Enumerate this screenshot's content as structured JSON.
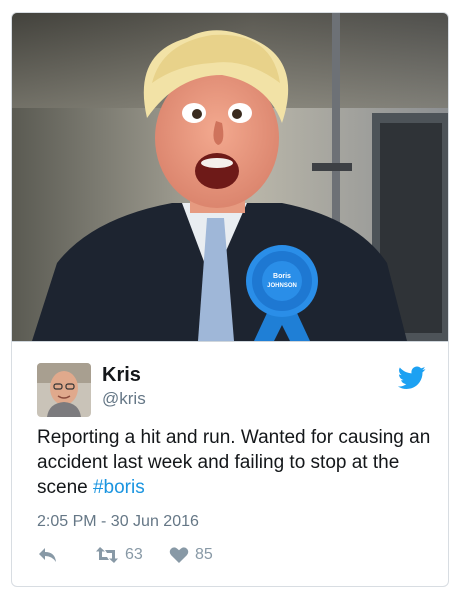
{
  "user": {
    "name": "Kris",
    "handle": "@kris"
  },
  "tweet": {
    "text_before": "Reporting a hit and run. Wanted for causing an accident last week and failing to stop at the scene ",
    "hashtag": "#boris",
    "timestamp": "2:05 PM - 30 Jun 2016"
  },
  "actions": {
    "retweets": "63",
    "likes": "85"
  },
  "rosette": {
    "line1": "Boris",
    "line2": "JOHNSON"
  },
  "colors": {
    "twitter_blue": "#1da1f2",
    "hashtag": "#1b95e0",
    "action_grey": "#8899a6"
  },
  "icons": {
    "reply": "reply-icon",
    "retweet": "retweet-icon",
    "like": "heart-icon",
    "brand": "twitter-bird-icon"
  }
}
